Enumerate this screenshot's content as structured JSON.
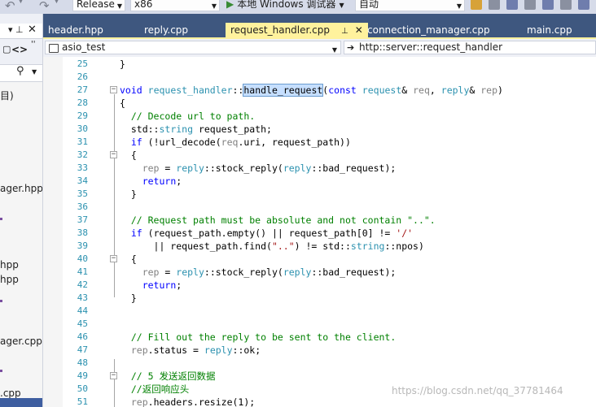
{
  "toolbar": {
    "config": "Release",
    "platform": "x86",
    "run_label": "本地 Windows 调试器",
    "mode": "自动"
  },
  "left_panel": {
    "items": [
      "目)",
      "ager.hpp",
      "hpp",
      "hpp",
      "ager.cpp",
      ".cpp"
    ]
  },
  "tabs": [
    {
      "label": "header.hpp"
    },
    {
      "label": "reply.cpp"
    },
    {
      "label": "request_handler.cpp",
      "active": true
    },
    {
      "label": "connection_manager.cpp"
    },
    {
      "label": "main.cpp"
    }
  ],
  "nav": {
    "project": "asio_test",
    "scope": "http::server::request_handler"
  },
  "editor": {
    "lines": [
      {
        "n": "25",
        "t": "}"
      },
      {
        "n": "26",
        "t": ""
      },
      {
        "n": "27",
        "t": "void request_handler::handle_request(const request& req, reply& rep)"
      },
      {
        "n": "28",
        "t": "{"
      },
      {
        "n": "29",
        "t": "  // Decode url to path."
      },
      {
        "n": "30",
        "t": "  std::string request_path;"
      },
      {
        "n": "31",
        "t": "  if (!url_decode(req.uri, request_path))"
      },
      {
        "n": "32",
        "t": "  {"
      },
      {
        "n": "33",
        "t": "    rep = reply::stock_reply(reply::bad_request);"
      },
      {
        "n": "34",
        "t": "    return;"
      },
      {
        "n": "35",
        "t": "  }"
      },
      {
        "n": "36",
        "t": ""
      },
      {
        "n": "37",
        "t": "  // Request path must be absolute and not contain \"..\"."
      },
      {
        "n": "38",
        "t": "  if (request_path.empty() || request_path[0] != '/'"
      },
      {
        "n": "39",
        "t": "      || request_path.find(\"..\") != std::string::npos)"
      },
      {
        "n": "40",
        "t": "  {"
      },
      {
        "n": "41",
        "t": "    rep = reply::stock_reply(reply::bad_request);"
      },
      {
        "n": "42",
        "t": "    return;"
      },
      {
        "n": "43",
        "t": "  }"
      },
      {
        "n": "44",
        "t": ""
      },
      {
        "n": "45",
        "t": ""
      },
      {
        "n": "46",
        "t": "  // Fill out the reply to be sent to the client."
      },
      {
        "n": "47",
        "t": "  rep.status = reply::ok;"
      },
      {
        "n": "48",
        "t": ""
      },
      {
        "n": "49",
        "t": "  // 5 发送返回数据"
      },
      {
        "n": "50",
        "t": "  //返回响应头"
      },
      {
        "n": "51",
        "t": "  rep.headers.resize(1);"
      }
    ]
  },
  "watermark": "https://blog.csdn.net/qq_37781464"
}
